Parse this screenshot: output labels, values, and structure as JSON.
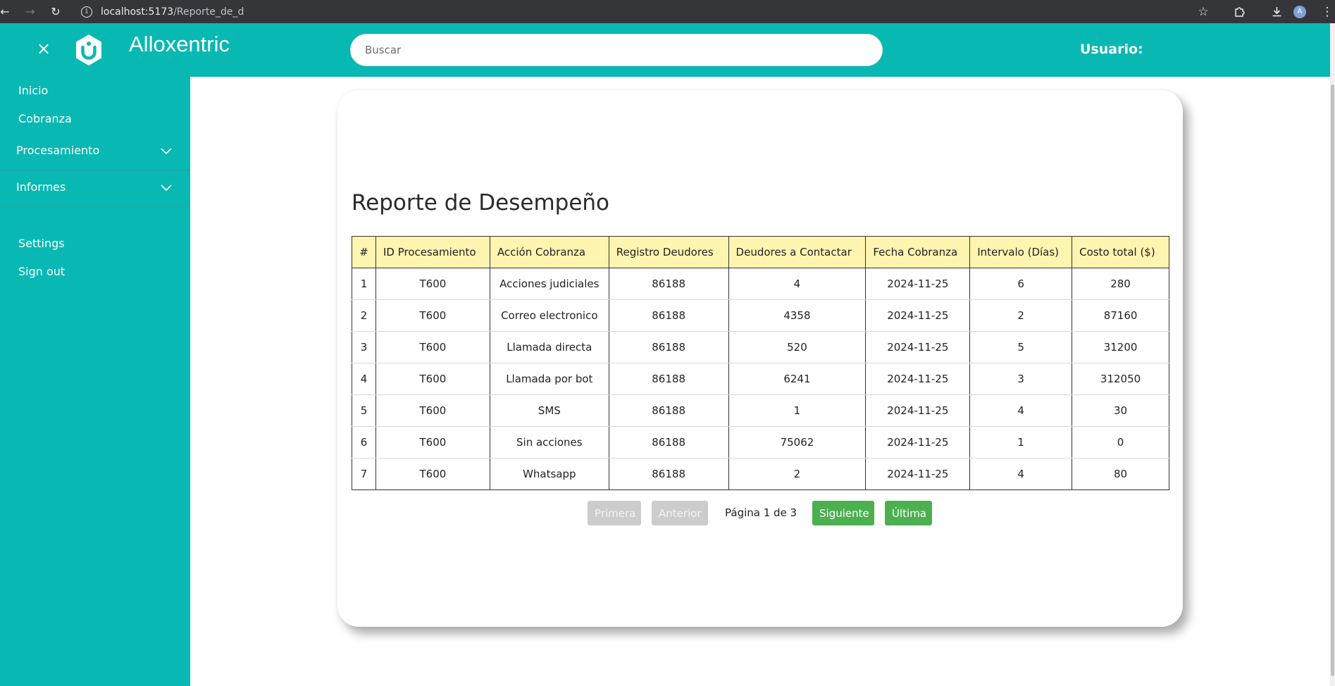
{
  "browser": {
    "url_host": "localhost:5173",
    "url_path": "/Reporte_de_d",
    "avatar_letter": "A"
  },
  "header": {
    "brand": "Alloxentric",
    "search_placeholder": "Buscar",
    "user_label": "Usuario:"
  },
  "sidebar": {
    "links": [
      {
        "label": "Inicio"
      },
      {
        "label": "Cobranza"
      }
    ],
    "groups": [
      {
        "label": "Procesamiento"
      },
      {
        "label": "Informes"
      }
    ],
    "bottom_links": [
      {
        "label": "Settings"
      },
      {
        "label": "Sign out"
      }
    ]
  },
  "report": {
    "title": "Reporte de Desempeño",
    "columns": [
      "#",
      "ID Procesamiento",
      "Acción Cobranza",
      "Registro Deudores",
      "Deudores a Contactar",
      "Fecha Cobranza",
      "Intervalo (Días)",
      "Costo total ($)"
    ],
    "rows": [
      [
        "1",
        "T600",
        "Acciones judiciales",
        "86188",
        "4",
        "2024-11-25",
        "6",
        "280"
      ],
      [
        "2",
        "T600",
        "Correo electronico",
        "86188",
        "4358",
        "2024-11-25",
        "2",
        "87160"
      ],
      [
        "3",
        "T600",
        "Llamada directa",
        "86188",
        "520",
        "2024-11-25",
        "5",
        "31200"
      ],
      [
        "4",
        "T600",
        "Llamada por bot",
        "86188",
        "6241",
        "2024-11-25",
        "3",
        "312050"
      ],
      [
        "5",
        "T600",
        "SMS",
        "86188",
        "1",
        "2024-11-25",
        "4",
        "30"
      ],
      [
        "6",
        "T600",
        "Sin acciones",
        "86188",
        "75062",
        "2024-11-25",
        "1",
        "0"
      ],
      [
        "7",
        "T600",
        "Whatsapp",
        "86188",
        "2",
        "2024-11-25",
        "4",
        "80"
      ]
    ]
  },
  "pagination": {
    "first": "Primera",
    "prev": "Anterior",
    "info": "Página 1 de 3",
    "next": "Siguiente",
    "last": "Última"
  },
  "colors": {
    "brand_teal": "#08b8b3",
    "header_yellow": "#fff4b0",
    "button_green": "#4caf50",
    "button_disabled": "#cccccc"
  }
}
